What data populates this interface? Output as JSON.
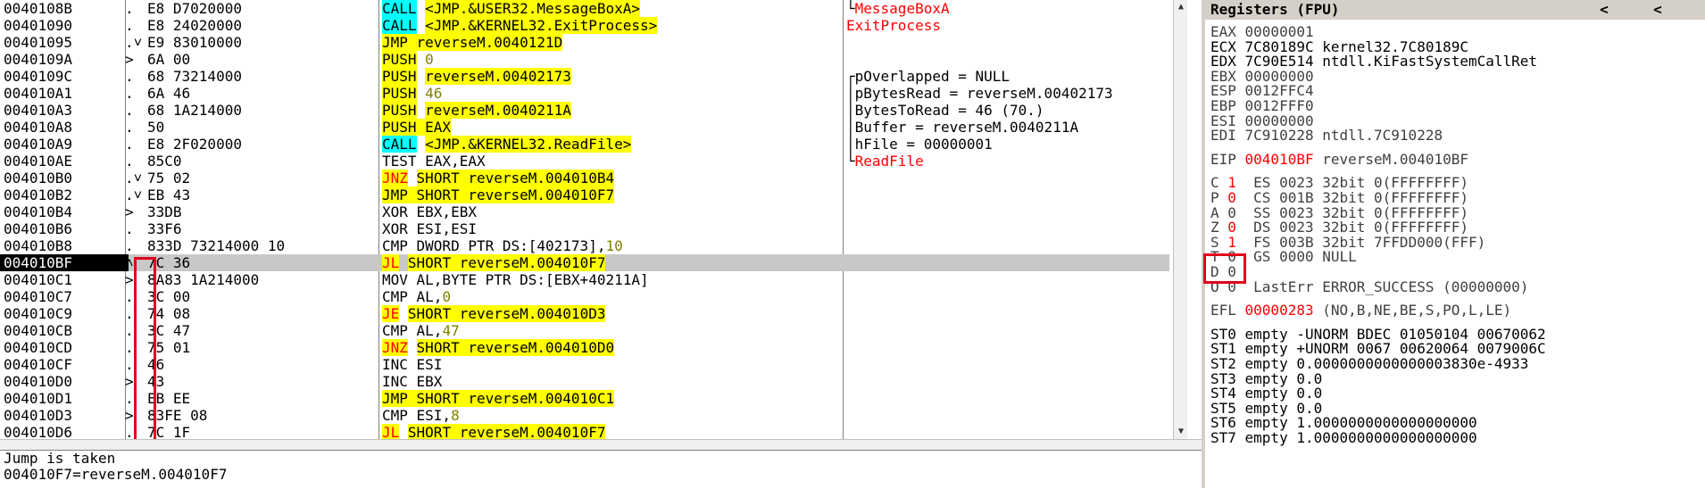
{
  "disasm_rows": [
    {
      "addr": "0040108B",
      "arrow": ".",
      "hex": "E8 D7020000",
      "parts": [
        [
          "CALL",
          "call"
        ],
        [
          " ",
          ""
        ],
        [
          "<JMP.&USER32.MessageBoxA>",
          "opyel"
        ]
      ],
      "cmt": [
        [
          "└",
          "box"
        ],
        [
          "MessageBoxA",
          "red"
        ]
      ]
    },
    {
      "addr": "00401090",
      "arrow": ".",
      "hex": "E8 24020000",
      "parts": [
        [
          "CALL",
          "call"
        ],
        [
          " ",
          ""
        ],
        [
          "<JMP.&KERNEL32.ExitProcess>",
          "opyel"
        ]
      ],
      "cmt": [
        [
          "ExitProcess",
          "red"
        ]
      ]
    },
    {
      "addr": "00401095",
      "arrow": ".˅",
      "hex": "E9 83010000",
      "parts": [
        [
          "JMP reverseM.0040121D",
          "mn"
        ]
      ],
      "cmt": []
    },
    {
      "addr": "0040109A",
      "arrow": ">",
      "hex": "6A 00",
      "parts": [
        [
          "PUSH",
          "mn"
        ],
        [
          " ",
          ""
        ],
        [
          "0",
          "num"
        ]
      ],
      "cmt": []
    },
    {
      "addr": "0040109C",
      "arrow": ".",
      "hex": "68 73214000",
      "parts": [
        [
          "PUSH",
          "mn"
        ],
        [
          " ",
          ""
        ],
        [
          "reverseM.00402173",
          "opyel"
        ]
      ],
      "cmt": [
        [
          "┌pOverlapped = NULL",
          ""
        ]
      ]
    },
    {
      "addr": "004010A1",
      "arrow": ".",
      "hex": "6A 46",
      "parts": [
        [
          "PUSH",
          "mn"
        ],
        [
          " ",
          ""
        ],
        [
          "46",
          "num"
        ]
      ],
      "cmt": [
        [
          "│pBytesRead = reverseM.00402173",
          ""
        ]
      ]
    },
    {
      "addr": "004010A3",
      "arrow": ".",
      "hex": "68 1A214000",
      "parts": [
        [
          "PUSH",
          "mn"
        ],
        [
          " ",
          ""
        ],
        [
          "reverseM.0040211A",
          "opyel"
        ]
      ],
      "cmt": [
        [
          "│BytesToRead = 46 (70.)",
          ""
        ]
      ]
    },
    {
      "addr": "004010A8",
      "arrow": ".",
      "hex": "50",
      "parts": [
        [
          "PUSH EAX",
          "mn"
        ]
      ],
      "cmt": [
        [
          "│Buffer = reverseM.0040211A",
          ""
        ]
      ]
    },
    {
      "addr": "004010A9",
      "arrow": ".",
      "hex": "E8 2F020000",
      "parts": [
        [
          "CALL",
          "call"
        ],
        [
          " ",
          ""
        ],
        [
          "<JMP.&KERNEL32.ReadFile>",
          "opyel"
        ]
      ],
      "cmt": [
        [
          "│hFile = 00000001",
          ""
        ]
      ]
    },
    {
      "addr": "004010AE",
      "arrow": ".",
      "hex": "85C0",
      "parts": [
        [
          "TEST EAX,EAX",
          ""
        ]
      ],
      "cmt": [
        [
          "└",
          "box"
        ],
        [
          "ReadFile",
          "red"
        ]
      ]
    },
    {
      "addr": "004010B0",
      "arrow": ".˅",
      "hex": "75 02",
      "parts": [
        [
          "JNZ",
          "jcc"
        ],
        [
          " ",
          ""
        ],
        [
          "SHORT reverseM.004010B4",
          "opyel"
        ]
      ],
      "cmt": []
    },
    {
      "addr": "004010B2",
      "arrow": ".˅",
      "hex": "EB 43",
      "parts": [
        [
          "JMP SHORT reverseM.004010F7",
          "mn"
        ]
      ],
      "cmt": []
    },
    {
      "addr": "004010B4",
      "arrow": ">",
      "hex": "33DB",
      "parts": [
        [
          "XOR EBX,EBX",
          ""
        ]
      ],
      "cmt": []
    },
    {
      "addr": "004010B6",
      "arrow": ".",
      "hex": "33F6",
      "parts": [
        [
          "XOR ESI,ESI",
          ""
        ]
      ],
      "cmt": []
    },
    {
      "addr": "004010B8",
      "arrow": ".",
      "hex": "833D 73214000 10",
      "parts": [
        [
          "CMP DWORD PTR DS:[402173],",
          ""
        ],
        [
          "10",
          "num"
        ]
      ],
      "cmt": []
    },
    {
      "addr": "004010BF",
      "arrow": "˄",
      "hex": "7C 36",
      "parts": [
        [
          "JL",
          "jcc"
        ],
        [
          " ",
          ""
        ],
        [
          "SHORT reverseM.004010F7",
          "opyel"
        ]
      ],
      "cmt": [],
      "sel": true
    },
    {
      "addr": "004010C1",
      "arrow": ">",
      "hex": "8A83 1A214000",
      "parts": [
        [
          "MOV AL,BYTE PTR DS:[EBX+40211A]",
          ""
        ]
      ],
      "cmt": []
    },
    {
      "addr": "004010C7",
      "arrow": ".",
      "hex": "3C 00",
      "parts": [
        [
          "CMP AL,",
          ""
        ],
        [
          "0",
          "num"
        ]
      ],
      "cmt": []
    },
    {
      "addr": "004010C9",
      "arrow": ".",
      "hex": "74 08",
      "parts": [
        [
          "JE",
          "jcc"
        ],
        [
          " ",
          ""
        ],
        [
          "SHORT reverseM.004010D3",
          "opyel"
        ]
      ],
      "cmt": []
    },
    {
      "addr": "004010CB",
      "arrow": ".",
      "hex": "3C 47",
      "parts": [
        [
          "CMP AL,",
          ""
        ],
        [
          "47",
          "num"
        ]
      ],
      "cmt": []
    },
    {
      "addr": "004010CD",
      "arrow": ".",
      "hex": "75 01",
      "parts": [
        [
          "JNZ",
          "jcc"
        ],
        [
          " ",
          ""
        ],
        [
          "SHORT reverseM.004010D0",
          "opyel"
        ]
      ],
      "cmt": []
    },
    {
      "addr": "004010CF",
      "arrow": ".",
      "hex": "46",
      "parts": [
        [
          "INC ESI",
          ""
        ]
      ],
      "cmt": []
    },
    {
      "addr": "004010D0",
      "arrow": ">",
      "hex": "43",
      "parts": [
        [
          "INC EBX",
          ""
        ]
      ],
      "cmt": []
    },
    {
      "addr": "004010D1",
      "arrow": ".",
      "hex": "EB EE",
      "parts": [
        [
          "JMP SHORT reverseM.004010C1",
          "mn"
        ]
      ],
      "cmt": []
    },
    {
      "addr": "004010D3",
      "arrow": ">",
      "hex": "83FE 08",
      "parts": [
        [
          "CMP ESI,",
          ""
        ],
        [
          "8",
          "num"
        ]
      ],
      "cmt": []
    },
    {
      "addr": "004010D6",
      "arrow": ".",
      "hex": "7C 1F",
      "parts": [
        [
          "JL",
          "jcc"
        ],
        [
          " ",
          ""
        ],
        [
          "SHORT reverseM.004010F7",
          "opyel"
        ]
      ],
      "cmt": []
    }
  ],
  "info": {
    "line1": "Jump is taken",
    "line2": "004010F7=reverseM.004010F7"
  },
  "regs": {
    "title": "Registers (FPU)",
    "btn1": "<",
    "btn2": "<",
    "rows": [
      {
        "t": "EAX 00000001",
        "c": "gray"
      },
      {
        "t": "ECX 7C80189C kernel32.7C80189C",
        "c": ""
      },
      {
        "t": "EDX 7C90E514 ntdll.KiFastSystemCallRet",
        "c": ""
      },
      {
        "t": "EBX 00000000",
        "c": "gray"
      },
      {
        "t": "ESP 0012FFC4",
        "c": "gray"
      },
      {
        "t": "EBP 0012FFF0",
        "c": "gray"
      },
      {
        "t": "ESI 00000000",
        "c": "gray"
      },
      {
        "t": "EDI 7C910228 ntdll.7C910228",
        "c": "gray"
      },
      {
        "t": "",
        "c": ""
      },
      {
        "eip": true,
        "pre": "EIP ",
        "val": "004010BF",
        "post": " reverseM.004010BF"
      },
      {
        "t": "",
        "c": ""
      },
      {
        "flag": "C",
        "fv": "1",
        "red": true,
        "post": "  ES 0023 32bit 0(FFFFFFFF)"
      },
      {
        "flag": "P",
        "fv": "0",
        "red": true,
        "post": "  CS 001B 32bit 0(FFFFFFFF)"
      },
      {
        "flag": "A",
        "fv": "0",
        "red": false,
        "post": "  SS 0023 32bit 0(FFFFFFFF)"
      },
      {
        "flag": "Z",
        "fv": "0",
        "red": true,
        "post": "  DS 0023 32bit 0(FFFFFFFF)"
      },
      {
        "flag": "S",
        "fv": "1",
        "red": true,
        "post": "  FS 003B 32bit 7FFDD000(FFF)"
      },
      {
        "flag": "T",
        "fv": "0",
        "red": false,
        "post": "  GS 0000 NULL"
      },
      {
        "flag": "D",
        "fv": "0",
        "red": false,
        "post": ""
      },
      {
        "flag": "O",
        "fv": "0",
        "red": false,
        "post": "  LastErr ERROR_SUCCESS (00000000)"
      },
      {
        "t": "",
        "c": ""
      },
      {
        "eip": true,
        "pre": "EFL ",
        "val": "00000283",
        "post": " (NO,B,NE,BE,S,PO,L,LE)"
      },
      {
        "t": "",
        "c": ""
      },
      {
        "t": "ST0 empty -UNORM BDEC 01050104 00670062",
        "c": ""
      },
      {
        "t": "ST1 empty +UNORM 0067 00620064 0079006C",
        "c": ""
      },
      {
        "t": "ST2 empty 0.0000000000000003830e-4933",
        "c": ""
      },
      {
        "t": "ST3 empty 0.0",
        "c": ""
      },
      {
        "t": "ST4 empty 0.0",
        "c": ""
      },
      {
        "t": "ST5 empty 0.0",
        "c": ""
      },
      {
        "t": "ST6 empty 1.0000000000000000000",
        "c": ""
      },
      {
        "t": "ST7 empty 1.0000000000000000000",
        "c": ""
      }
    ]
  },
  "scroll": {
    "up": "▲",
    "down": "▼"
  },
  "colors": {
    "highlight_box": "#e0001b",
    "mnemonic_bg": "#ffff00",
    "call_bg": "#00ffff",
    "jcc_fg": "#ff0000"
  }
}
